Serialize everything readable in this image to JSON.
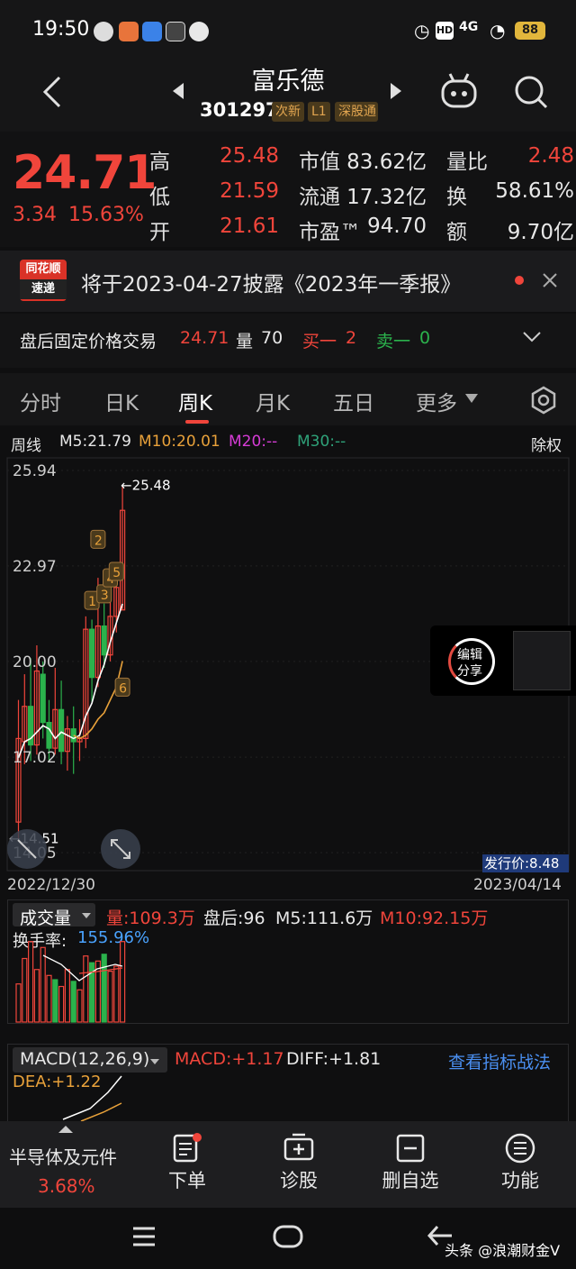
{
  "status_bar": {
    "time": "19:50",
    "battery": "88",
    "network": "4G"
  },
  "header": {
    "name": "富乐德",
    "code": "301297",
    "tags": [
      "次新",
      "L1",
      "深股通"
    ]
  },
  "quote": {
    "price": "24.71",
    "change": "3.34",
    "change_pct": "15.63%",
    "rows": [
      {
        "l1": "高",
        "v1": "25.48",
        "l2": "市值",
        "v2": "83.62亿",
        "l3": "量比",
        "v3": "2.48"
      },
      {
        "l1": "低",
        "v1": "21.59",
        "l2": "流通",
        "v2": "17.32亿",
        "l3": "换",
        "v3": "58.61%"
      },
      {
        "l1": "开",
        "v1": "21.61",
        "l2": "市盈™",
        "v2": "94.70",
        "l3": "额",
        "v3": "9.70亿"
      }
    ]
  },
  "notice": {
    "logo_top": "同花顺",
    "logo_bottom": "速递",
    "text": "将于2023-04-27披露《2023年一季报》"
  },
  "after_hours": {
    "label": "盘后固定价格交易",
    "price": "24.71",
    "vol_label": "量",
    "vol": "70",
    "buy_label": "买一",
    "buy": "2",
    "sell_label": "卖一",
    "sell": "0"
  },
  "tabs": [
    "分时",
    "日K",
    "周K",
    "月K",
    "五日",
    "更多"
  ],
  "active_tab": "周K",
  "chart_head": {
    "period": "周线",
    "m5": "M5:21.79",
    "m10": "M10:20.01",
    "m20": "M20:--",
    "m30": "M30:--",
    "adjust": "除权"
  },
  "chart_data": {
    "type": "candlestick",
    "y_ticks": [
      "25.94",
      "22.97",
      "20.00",
      "17.02",
      "14.05"
    ],
    "ylim": [
      14.05,
      25.94
    ],
    "x_start": "2022/12/30",
    "x_end": "2023/04/14",
    "high_label": "25.48",
    "low_label": "14.51",
    "issue_price": "发行价:8.48",
    "markers": [
      "1",
      "2",
      "3",
      "4",
      "5",
      "6"
    ],
    "candles": [
      {
        "o": 15.0,
        "c": 17.6,
        "h": 18.8,
        "l": 14.5
      },
      {
        "o": 17.5,
        "c": 18.6,
        "h": 19.6,
        "l": 16.8
      },
      {
        "o": 18.6,
        "c": 17.4,
        "h": 20.1,
        "l": 16.9
      },
      {
        "o": 17.4,
        "c": 19.7,
        "h": 20.5,
        "l": 17.1
      },
      {
        "o": 19.6,
        "c": 18.1,
        "h": 20.0,
        "l": 17.6
      },
      {
        "o": 18.1,
        "c": 17.3,
        "h": 18.8,
        "l": 16.9
      },
      {
        "o": 17.3,
        "c": 18.5,
        "h": 19.8,
        "l": 17.1
      },
      {
        "o": 18.5,
        "c": 17.2,
        "h": 19.4,
        "l": 16.8
      },
      {
        "o": 17.2,
        "c": 17.9,
        "h": 18.3,
        "l": 16.6
      },
      {
        "o": 17.9,
        "c": 17.5,
        "h": 18.6,
        "l": 16.5
      },
      {
        "o": 17.5,
        "c": 17.6,
        "h": 18.2,
        "l": 16.9
      },
      {
        "o": 17.6,
        "c": 21.0,
        "h": 21.4,
        "l": 17.3
      },
      {
        "o": 21.0,
        "c": 19.5,
        "h": 21.3,
        "l": 18.7
      },
      {
        "o": 19.5,
        "c": 21.1,
        "h": 22.6,
        "l": 19.2
      },
      {
        "o": 21.1,
        "c": 20.2,
        "h": 21.8,
        "l": 19.8
      },
      {
        "o": 20.2,
        "c": 21.4,
        "h": 22.0,
        "l": 20.0
      },
      {
        "o": 21.4,
        "c": 22.3,
        "h": 22.8,
        "l": 20.9
      },
      {
        "o": 21.6,
        "c": 24.7,
        "h": 25.48,
        "l": 21.59
      }
    ],
    "ma5": [
      17.0,
      17.5,
      17.6,
      17.8,
      18.0,
      17.9,
      17.6,
      17.8,
      17.7,
      17.6,
      17.7,
      18.3,
      18.7,
      19.4,
      19.9,
      20.6,
      21.2,
      21.79
    ],
    "ma10": [
      null,
      null,
      null,
      null,
      null,
      null,
      null,
      null,
      null,
      17.7,
      17.6,
      17.7,
      17.9,
      18.2,
      18.4,
      18.8,
      19.2,
      20.01
    ]
  },
  "volume": {
    "title": "成交量",
    "vol": "量:109.3万",
    "after": "盘后:96",
    "m5": "M5:111.6万",
    "m10": "M10:92.15万",
    "turnover_label": "换手率:",
    "turnover": "155.96%",
    "bars": [
      0.45,
      0.75,
      0.95,
      0.62,
      0.88,
      0.55,
      0.5,
      0.42,
      0.62,
      0.48,
      0.38,
      0.78,
      0.7,
      0.72,
      0.8,
      0.6,
      0.66,
      0.95
    ],
    "colors": [
      "r",
      "r",
      "r",
      "r",
      "r",
      "r",
      "g",
      "r",
      "r",
      "g",
      "r",
      "r",
      "g",
      "r",
      "g",
      "r",
      "r",
      "r"
    ]
  },
  "macd": {
    "title": "MACD(12,26,9)",
    "macd": "MACD:+1.17",
    "diff": "DIFF:+1.81",
    "dea": "DEA:+1.22",
    "link": "查看指标战法"
  },
  "floater": {
    "line1": "编辑",
    "line2": "分享"
  },
  "bottom": {
    "sector": "半导体及元件",
    "sector_pct": "3.68%",
    "buttons": [
      "下单",
      "诊股",
      "删自选",
      "功能"
    ]
  },
  "watermark": "头条 @浪潮财金V",
  "colors": {
    "up": "#f0453b",
    "down": "#2bb24c",
    "ma5": "#ffffff",
    "ma10": "#e8a13a",
    "ma20": "#d63cd6",
    "ma30": "#2fa37a"
  }
}
